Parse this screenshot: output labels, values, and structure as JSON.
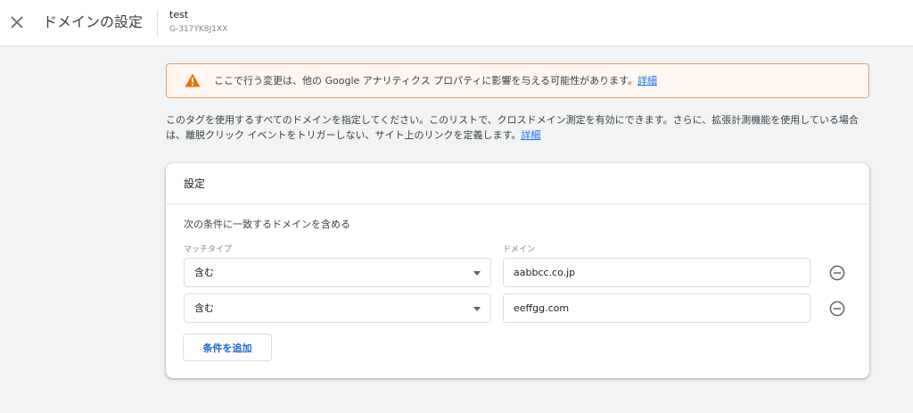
{
  "header": {
    "close_icon": "close-icon",
    "title": "ドメインの設定",
    "property_name": "test",
    "property_id": "G-317YK8J1XX"
  },
  "warning": {
    "icon": "warning-icon",
    "icon_color": "#e37400",
    "text": "ここで行う変更は、他の Google アナリティクス プロパティに影響を与える可能性があります。",
    "link": "詳細"
  },
  "description": {
    "text": "このタグを使用するすべてのドメインを指定してください。このリストで、クロスドメイン測定を有効にできます。さらに、拡張計測機能を使用している場合は、離脱クリック イベントをトリガーしない、サイト上のリンクを定義します。",
    "link": "詳細"
  },
  "settings": {
    "title": "設定",
    "condition_heading": "次の条件に一致するドメインを含める",
    "match_type_label": "マッチタイプ",
    "domain_label": "ドメイン",
    "conditions": [
      {
        "match_type": "含む",
        "domain": "aabbcc.co.jp"
      },
      {
        "match_type": "含む",
        "domain": "eeffgg.com"
      }
    ],
    "add_button": "条件を追加"
  },
  "colors": {
    "accent": "#1a73e8",
    "warning_border": "#e8a063",
    "warning_bg": "#fef7f1",
    "page_bg": "#f1f3f4"
  }
}
